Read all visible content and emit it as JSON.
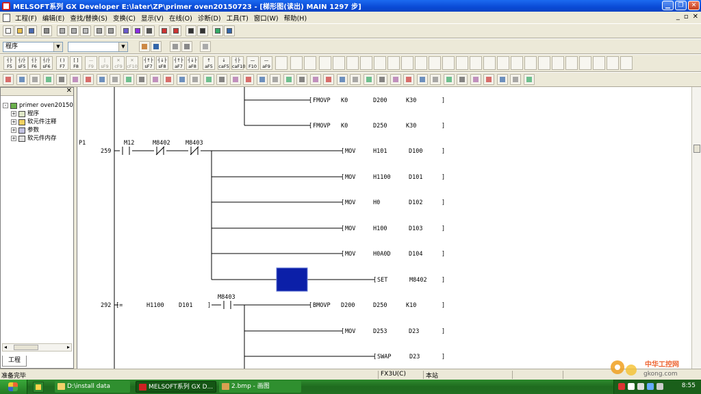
{
  "window": {
    "title": "MELSOFT系列 GX Developer E:\\later\\ZP\\primer oven20150723 - [梯形图(读出)    MAIN    1297 步]"
  },
  "menu": {
    "items": [
      "工程(F)",
      "编辑(E)",
      "查找/替换(S)",
      "变换(C)",
      "显示(V)",
      "在线(O)",
      "诊断(D)",
      "工具(T)",
      "窗口(W)",
      "帮助(H)"
    ]
  },
  "toolbar": {
    "program_combo": "程序",
    "second_combo": ""
  },
  "ladder_buttons": [
    {
      "top": "┤├",
      "bottom": "F5"
    },
    {
      "top": "┤/├",
      "bottom": "sF5"
    },
    {
      "top": "┤├",
      "bottom": "F6"
    },
    {
      "top": "┤/├",
      "bottom": "sF6"
    },
    {
      "top": "( )",
      "bottom": "F7"
    },
    {
      "top": "[ ]",
      "bottom": "F8"
    },
    {
      "top": "—",
      "bottom": "F9"
    },
    {
      "top": "|",
      "bottom": "sF9"
    },
    {
      "top": "✕",
      "bottom": "cF9"
    },
    {
      "top": "✕",
      "bottom": "cF10"
    },
    {
      "top": "┤↑├",
      "bottom": "sF7"
    },
    {
      "top": "┤↓├",
      "bottom": "sF8"
    },
    {
      "top": "┤↑├",
      "bottom": "aF7"
    },
    {
      "top": "┤↓├",
      "bottom": "aF8"
    },
    {
      "top": "↑",
      "bottom": "aF5"
    },
    {
      "top": "↓",
      "bottom": "caF5"
    },
    {
      "top": "┤├",
      "bottom": "caF10"
    },
    {
      "top": "—",
      "bottom": "F10"
    },
    {
      "top": "—",
      "bottom": "aF9"
    }
  ],
  "project_pane": {
    "tab": "工程",
    "tree": [
      {
        "label": "primer oven20150",
        "level": 0,
        "expander": "-"
      },
      {
        "label": "程序",
        "level": 1,
        "expander": "+"
      },
      {
        "label": "软元件注释",
        "level": 1,
        "expander": "+"
      },
      {
        "label": "参数",
        "level": 1,
        "expander": "+"
      },
      {
        "label": "软元件内存",
        "level": 1,
        "expander": "+"
      }
    ]
  },
  "ladder": {
    "pointer_label": "P1",
    "step_numbers": [
      "259",
      "292"
    ],
    "contacts": [
      {
        "device": "M12",
        "type": "NO"
      },
      {
        "device": "M8402",
        "type": "NC"
      },
      {
        "device": "M8403",
        "type": "NC"
      },
      {
        "device": "M8403",
        "type": "NO"
      }
    ],
    "compare": {
      "op": "[=",
      "arg1": "H1100",
      "arg2": "D101",
      "close": "]"
    },
    "instructions": [
      {
        "op": "FMOVP",
        "args": [
          "K0",
          "D200",
          "K30"
        ]
      },
      {
        "op": "FMOVP",
        "args": [
          "K0",
          "D250",
          "K30"
        ]
      },
      {
        "op": "MOV",
        "args": [
          "H101",
          "D100"
        ]
      },
      {
        "op": "MOV",
        "args": [
          "H1100",
          "D101"
        ]
      },
      {
        "op": "MOV",
        "args": [
          "H0",
          "D102"
        ]
      },
      {
        "op": "MOV",
        "args": [
          "H100",
          "D103"
        ]
      },
      {
        "op": "MOV",
        "args": [
          "H0A0D",
          "D104"
        ]
      },
      {
        "op": "SET",
        "args": [
          "M8402"
        ]
      },
      {
        "op": "BMOVP",
        "args": [
          "D200",
          "D250",
          "K10"
        ]
      },
      {
        "op": "MOV",
        "args": [
          "D253",
          "D23"
        ]
      },
      {
        "op": "SWAP",
        "args": [
          "D23"
        ]
      }
    ],
    "cursor_color": "#0b1fa8"
  },
  "statusbar": {
    "ready": "准备完毕",
    "plc_type": "FX3U(C)",
    "station": "本站"
  },
  "taskbar": {
    "tasks": [
      "D:\\install data",
      "MELSOFT系列 GX D...",
      "2.bmp - 画图"
    ],
    "clock": "8:55"
  },
  "watermark": {
    "site": "中华工控网",
    "domain": "gkong.com"
  }
}
